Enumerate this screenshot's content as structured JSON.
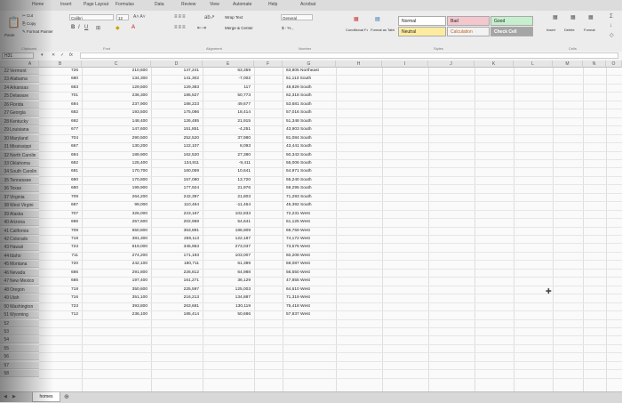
{
  "ribbon": {
    "tabs": [
      "Home",
      "Insert",
      "Page Layout",
      "Formulas",
      "Data",
      "Review",
      "View",
      "Automate",
      "Help",
      "Acrobat"
    ],
    "clipboard": {
      "paste": "Paste",
      "cut": "Cut",
      "copy": "Copy",
      "format_painter": "Format Painter",
      "label": "Clipboard"
    },
    "font": {
      "name": "Calibri",
      "size": "12",
      "label": "Font"
    },
    "alignment": {
      "wrap": "Wrap Text",
      "merge": "Merge & Center",
      "label": "Alignment"
    },
    "number": {
      "format": "General",
      "currency": "$ - % ,",
      "label": "Number"
    },
    "styles": {
      "conditional": "Conditional Formatting",
      "format_table": "Format as Table",
      "normal": "Normal",
      "neutral": "Neutral",
      "bad": "Bad",
      "good": "Good",
      "calculation": "Calculation",
      "check_cell": "Check Cell",
      "label": "Styles"
    },
    "cells": {
      "insert": "Insert",
      "delete": "Delete",
      "format": "Format",
      "label": "Cells"
    }
  },
  "formula_bar": {
    "name_box": "H31",
    "fx": "fx"
  },
  "columns": [
    "A",
    "B",
    "C",
    "D",
    "E",
    "F",
    "G",
    "H",
    "I",
    "J",
    "K",
    "L",
    "M",
    "N",
    "O"
  ],
  "rows": [
    {
      "n": "22",
      "state": "Vermont",
      "b": "726",
      "c": "210,600",
      "d": "147,241",
      "e": "63,359",
      "g": "63,805 Northeast"
    },
    {
      "n": "23",
      "state": "Alabama",
      "b": "680",
      "c": "134,300",
      "d": "141,302",
      "e": "-7,002",
      "g": "51,113 South"
    },
    {
      "n": "24",
      "state": "Arkansas",
      "b": "683",
      "c": "129,500",
      "d": "129,383",
      "e": "117",
      "g": "48,829 South"
    },
    {
      "n": "25",
      "state": "Delaware",
      "b": "701",
      "c": "236,300",
      "d": "185,527",
      "e": "50,773",
      "g": "62,318 South"
    },
    {
      "n": "26",
      "state": "Florida",
      "b": "694",
      "c": "237,900",
      "d": "188,223",
      "e": "49,677",
      "g": "53,681 South"
    },
    {
      "n": "27",
      "state": "Georgia",
      "b": "682",
      "c": "193,500",
      "d": "175,086",
      "e": "18,414",
      "g": "57,016 South"
    },
    {
      "n": "28",
      "state": "Kentucky",
      "b": "692",
      "c": "148,400",
      "d": "126,485",
      "e": "21,915",
      "g": "51,348 South"
    },
    {
      "n": "29",
      "state": "Louisiana",
      "b": "677",
      "c": "147,600",
      "d": "151,851",
      "e": "-4,251",
      "g": "43,903 South"
    },
    {
      "n": "30",
      "state": "Maryland",
      "b": "704",
      "c": "290,500",
      "d": "252,520",
      "e": "37,980",
      "g": "81,084 South"
    },
    {
      "n": "31",
      "state": "Mississippi",
      "b": "667",
      "c": "130,200",
      "d": "122,107",
      "e": "8,093",
      "g": "43,441 South"
    },
    {
      "n": "32",
      "state": "North Carolin",
      "b": "694",
      "c": "189,900",
      "d": "162,520",
      "e": "27,380",
      "g": "50,343 South"
    },
    {
      "n": "33",
      "state": "Oklahoma",
      "b": "682",
      "c": "125,400",
      "d": "134,811",
      "e": "-9,411",
      "g": "55,006 South"
    },
    {
      "n": "34",
      "state": "South Carolin",
      "b": "681",
      "c": "170,700",
      "d": "160,059",
      "e": "10,641",
      "g": "54,971 South"
    },
    {
      "n": "35",
      "state": "Tennessee",
      "b": "690",
      "c": "170,800",
      "d": "157,080",
      "e": "13,720",
      "g": "55,240 South"
    },
    {
      "n": "36",
      "state": "Texas",
      "b": "680",
      "c": "199,900",
      "d": "177,924",
      "e": "21,976",
      "g": "59,295 South"
    },
    {
      "n": "37",
      "state": "Virginia",
      "b": "709",
      "c": "264,200",
      "d": "242,397",
      "e": "21,803",
      "g": "71,293 South"
    },
    {
      "n": "38",
      "state": "West Virgini",
      "b": "687",
      "c": "99,000",
      "d": "110,464",
      "e": "-11,464",
      "g": "45,392 South"
    },
    {
      "n": "39",
      "state": "Alaska",
      "b": "707",
      "c": "326,000",
      "d": "223,167",
      "e": "102,833",
      "g": "72,231 West"
    },
    {
      "n": "40",
      "state": "Arizona",
      "b": "696",
      "c": "257,600",
      "d": "202,959",
      "e": "54,641",
      "g": "61,125 West"
    },
    {
      "n": "41",
      "state": "California",
      "b": "708",
      "c": "550,800",
      "d": "363,891",
      "e": "186,909",
      "g": "69,759 West"
    },
    {
      "n": "42",
      "state": "Colorado",
      "b": "718",
      "c": "381,300",
      "d": "259,113",
      "e": "122,187",
      "g": "74,172 West"
    },
    {
      "n": "43",
      "state": "Hawaii",
      "b": "723",
      "c": "619,000",
      "d": "345,963",
      "e": "273,037",
      "g": "73,575 West"
    },
    {
      "n": "44",
      "state": "Idaho",
      "b": "711",
      "c": "274,200",
      "d": "171,193",
      "e": "103,007",
      "g": "60,208 West"
    },
    {
      "n": "45",
      "state": "Montana",
      "b": "720",
      "c": "242,100",
      "d": "180,711",
      "e": "61,389",
      "g": "59,087 West"
    },
    {
      "n": "46",
      "state": "Nevada",
      "b": "686",
      "c": "291,800",
      "d": "226,812",
      "e": "64,988",
      "g": "56,550 West"
    },
    {
      "n": "47",
      "state": "New Mexico",
      "b": "686",
      "c": "197,400",
      "d": "161,271",
      "e": "36,129",
      "g": "47,855 West"
    },
    {
      "n": "48",
      "state": "Oregon",
      "b": "718",
      "c": "350,600",
      "d": "225,597",
      "e": "125,003",
      "g": "64,610 West"
    },
    {
      "n": "49",
      "state": "Utah",
      "b": "716",
      "c": "351,100",
      "d": "216,213",
      "e": "134,887",
      "g": "71,319 West"
    },
    {
      "n": "50",
      "state": "Washington",
      "b": "723",
      "c": "393,800",
      "d": "263,681",
      "e": "130,119",
      "g": "75,418 West"
    },
    {
      "n": "51",
      "state": "Wyoming",
      "b": "712",
      "c": "236,100",
      "d": "185,414",
      "e": "50,686",
      "g": "57,837 West"
    },
    {
      "n": "52",
      "state": "",
      "b": "",
      "c": "",
      "d": "",
      "e": "",
      "g": ""
    },
    {
      "n": "53",
      "state": "",
      "b": "",
      "c": "",
      "d": "",
      "e": "",
      "g": ""
    },
    {
      "n": "54",
      "state": "",
      "b": "",
      "c": "",
      "d": "",
      "e": "",
      "g": ""
    },
    {
      "n": "55",
      "state": "",
      "b": "",
      "c": "",
      "d": "",
      "e": "",
      "g": ""
    },
    {
      "n": "56",
      "state": "",
      "b": "",
      "c": "",
      "d": "",
      "e": "",
      "g": ""
    },
    {
      "n": "57",
      "state": "",
      "b": "",
      "c": "",
      "d": "",
      "e": "",
      "g": ""
    },
    {
      "n": "58",
      "state": "",
      "b": "",
      "c": "",
      "d": "",
      "e": "",
      "g": ""
    }
  ],
  "sheet_tab": "homes",
  "colors": {
    "bad": "#f4c7ce",
    "neutral": "#fdeba0",
    "good": "#c6efce",
    "calculation": "#f2f2f2",
    "check_cell": "#a5a5a5",
    "grid_bg": "#fafafa"
  }
}
